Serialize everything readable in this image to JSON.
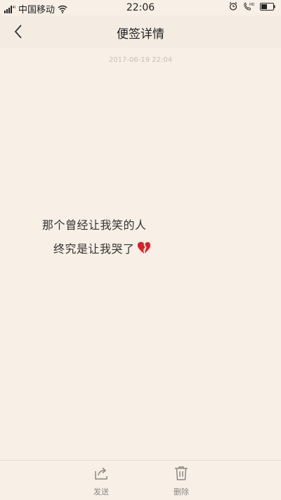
{
  "status_bar": {
    "carrier": "中国移动",
    "time": "22:06",
    "hd_label": "HD"
  },
  "header": {
    "title": "便签详情"
  },
  "note": {
    "timestamp": "2017-06-19 22:04",
    "line1": "那个曾经让我笑的人",
    "line2": "终究是让我哭了",
    "emoji": "broken-heart-icon"
  },
  "bottom_bar": {
    "send_label": "发送",
    "delete_label": "删除"
  },
  "colors": {
    "background": "#f8efe6",
    "emoji_red": "#d8202a"
  }
}
